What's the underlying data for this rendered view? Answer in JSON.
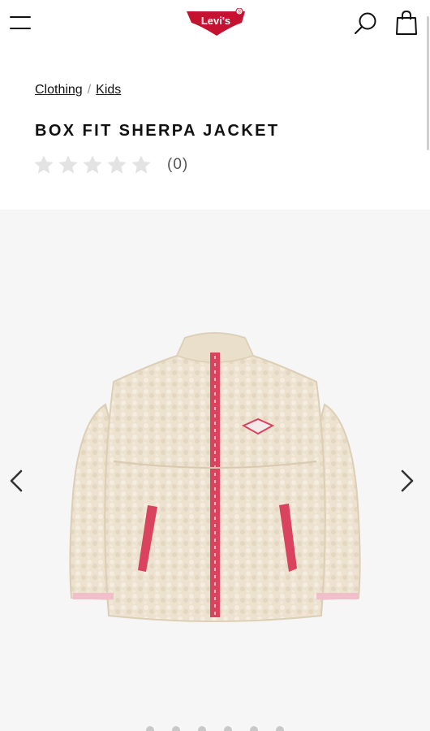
{
  "header": {
    "menu_icon": "hamburger-menu-icon",
    "logo_text": "Levi's",
    "logo_registered": "®",
    "search_icon": "search-icon",
    "bag_icon": "shopping-bag-icon",
    "brand_color": "#c41230"
  },
  "breadcrumb": {
    "items": [
      {
        "label": "Clothing"
      },
      {
        "label": "Kids"
      }
    ],
    "separator": "/"
  },
  "product": {
    "title": "BOX FIT SHERPA JACKET",
    "rating": 0,
    "rating_max": 5,
    "review_count": "(0)"
  },
  "gallery": {
    "prev_icon": "chevron-left-icon",
    "next_icon": "chevron-right-icon",
    "background": "#f6f6f6",
    "jacket_colors": {
      "sherpa": "#efe6d4",
      "trim": "#d9435e"
    }
  }
}
